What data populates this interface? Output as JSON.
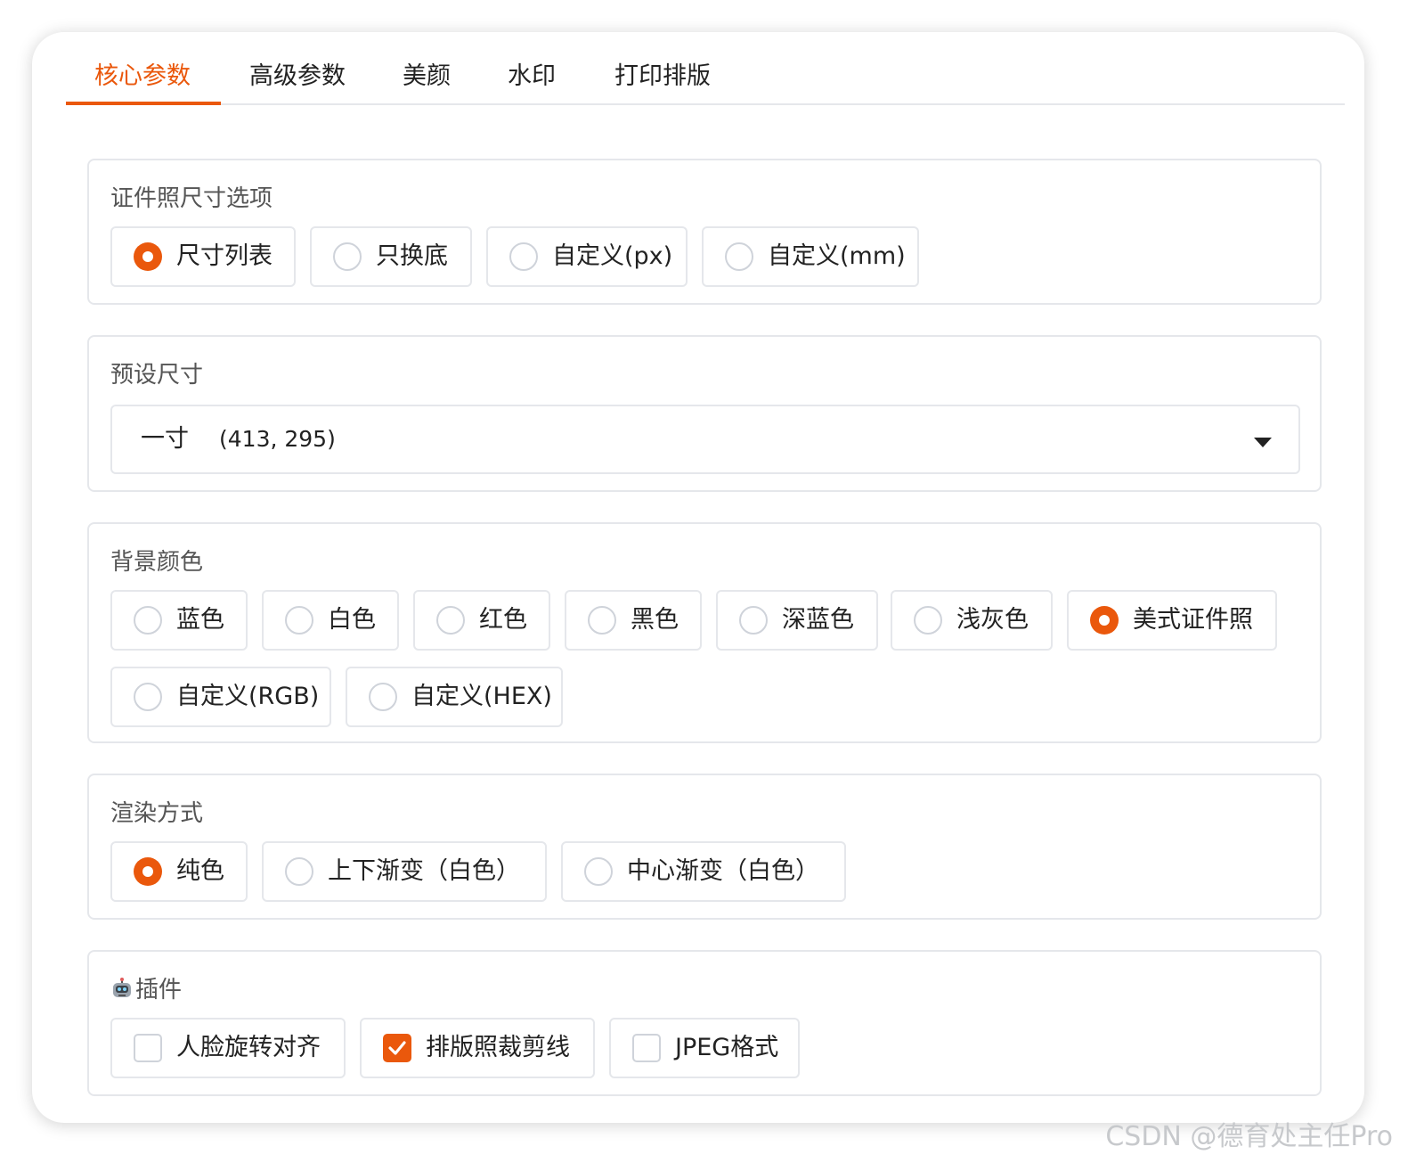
{
  "tabs": [
    {
      "label": "核心参数",
      "active": true
    },
    {
      "label": "高级参数",
      "active": false
    },
    {
      "label": "美颜",
      "active": false
    },
    {
      "label": "水印",
      "active": false
    },
    {
      "label": "打印排版",
      "active": false
    }
  ],
  "size_options": {
    "label": "证件照尺寸选项",
    "options": [
      "尺寸列表",
      "只换底",
      "自定义(px)",
      "自定义(mm)"
    ],
    "selected": "尺寸列表"
  },
  "preset_size": {
    "label": "预设尺寸",
    "selected_name": "一寸",
    "selected_value": "(413, 295)"
  },
  "background_color": {
    "label": "背景颜色",
    "options": [
      "蓝色",
      "白色",
      "红色",
      "黑色",
      "深蓝色",
      "浅灰色",
      "美式证件照",
      "自定义(RGB)",
      "自定义(HEX)"
    ],
    "selected": "美式证件照"
  },
  "render_mode": {
    "label": "渲染方式",
    "options": [
      "纯色",
      "上下渐变（白色）",
      "中心渐变（白色）"
    ],
    "selected": "纯色"
  },
  "plugins": {
    "label": "插件",
    "icon": "robot-icon",
    "options": [
      {
        "label": "人脸旋转对齐",
        "checked": false
      },
      {
        "label": "排版照裁剪线",
        "checked": true
      },
      {
        "label": "JPEG格式",
        "checked": false
      }
    ]
  },
  "watermark": "CSDN @德育处主任Pro",
  "colors": {
    "accent": "#ea580c",
    "border": "#e5e7eb",
    "text": "#222222"
  }
}
